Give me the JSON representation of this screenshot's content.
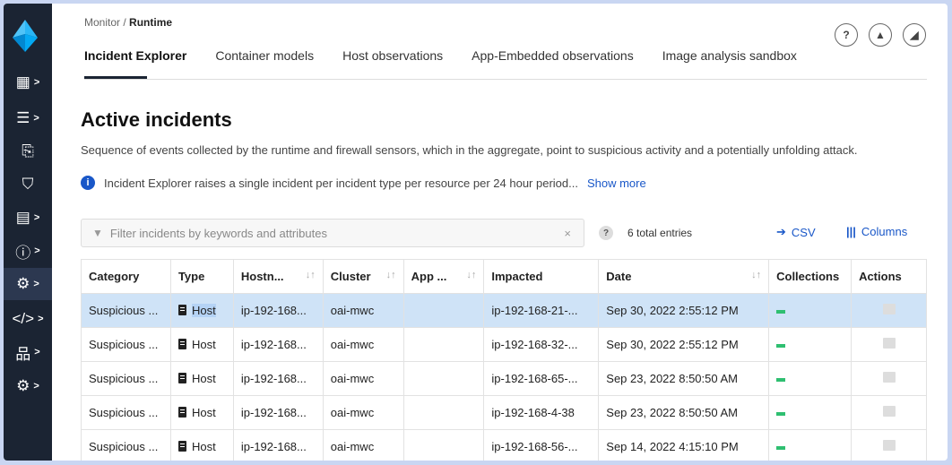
{
  "breadcrumb": {
    "parent": "Monitor",
    "separator": " / ",
    "current": "Runtime"
  },
  "top_icons": [
    {
      "name": "help-icon",
      "glyph": "?"
    },
    {
      "name": "bell-icon",
      "glyph": "▲"
    },
    {
      "name": "chart-icon",
      "glyph": "◢"
    }
  ],
  "tabs": [
    {
      "label": "Incident Explorer",
      "active": true
    },
    {
      "label": "Container models",
      "active": false
    },
    {
      "label": "Host observations",
      "active": false
    },
    {
      "label": "App-Embedded observations",
      "active": false
    },
    {
      "label": "Image analysis sandbox",
      "active": false
    }
  ],
  "page": {
    "title": "Active incidents",
    "description": "Sequence of events collected by the runtime and firewall sensors, which in the aggregate, point to suspicious activity and a potentially unfolding attack.",
    "info_text": "Incident Explorer raises a single incident per incident type per resource per 24 hour period...",
    "show_more": "Show more"
  },
  "filter": {
    "placeholder": "Filter incidents by keywords and attributes",
    "clear": "×"
  },
  "toolbar": {
    "help": "?",
    "entries": "6 total entries",
    "csv_label": "CSV",
    "columns_label": "Columns"
  },
  "table": {
    "headers": [
      "Category",
      "Type",
      "Hostn...",
      "Cluster",
      "App ...",
      "Impacted",
      "Date",
      "Collections",
      "Actions"
    ],
    "sort_glyph": "↓↑",
    "rows": [
      {
        "category": "Suspicious ...",
        "type": "Host",
        "hostname": "ip-192-168...",
        "cluster": "oai-mwc",
        "app": "",
        "impacted": "ip-192-168-21-...",
        "date": "Sep 30, 2022 2:55:12 PM",
        "selected": true
      },
      {
        "category": "Suspicious ...",
        "type": "Host",
        "hostname": "ip-192-168...",
        "cluster": "oai-mwc",
        "app": "",
        "impacted": "ip-192-168-32-...",
        "date": "Sep 30, 2022 2:55:12 PM",
        "selected": false
      },
      {
        "category": "Suspicious ...",
        "type": "Host",
        "hostname": "ip-192-168...",
        "cluster": "oai-mwc",
        "app": "",
        "impacted": "ip-192-168-65-...",
        "date": "Sep 23, 2022 8:50:50 AM",
        "selected": false
      },
      {
        "category": "Suspicious ...",
        "type": "Host",
        "hostname": "ip-192-168...",
        "cluster": "oai-mwc",
        "app": "",
        "impacted": "ip-192-168-4-38",
        "date": "Sep 23, 2022 8:50:50 AM",
        "selected": false
      },
      {
        "category": "Suspicious ...",
        "type": "Host",
        "hostname": "ip-192-168...",
        "cluster": "oai-mwc",
        "app": "",
        "impacted": "ip-192-168-56-...",
        "date": "Sep 14, 2022 4:15:10 PM",
        "selected": false
      }
    ]
  },
  "sidebar": {
    "items": [
      {
        "name": "dashboard-icon",
        "glyph": "▦"
      },
      {
        "name": "list-icon",
        "glyph": "☰"
      },
      {
        "name": "scan-icon",
        "glyph": "⎘"
      },
      {
        "name": "shield-icon",
        "glyph": "⛉"
      },
      {
        "name": "compliance-icon",
        "glyph": "▤"
      },
      {
        "name": "alert-icon",
        "glyph": "ⓘ"
      },
      {
        "name": "runtime-icon",
        "glyph": "⚙"
      },
      {
        "name": "code-icon",
        "glyph": "</>"
      },
      {
        "name": "network-icon",
        "glyph": "品"
      },
      {
        "name": "settings-icon",
        "glyph": "⚙"
      }
    ]
  },
  "colors": {
    "accent": "#1957c8",
    "sidebar": "#1b2433",
    "selected_row": "#cfe3f7",
    "collection_status": "#2fbf71"
  }
}
